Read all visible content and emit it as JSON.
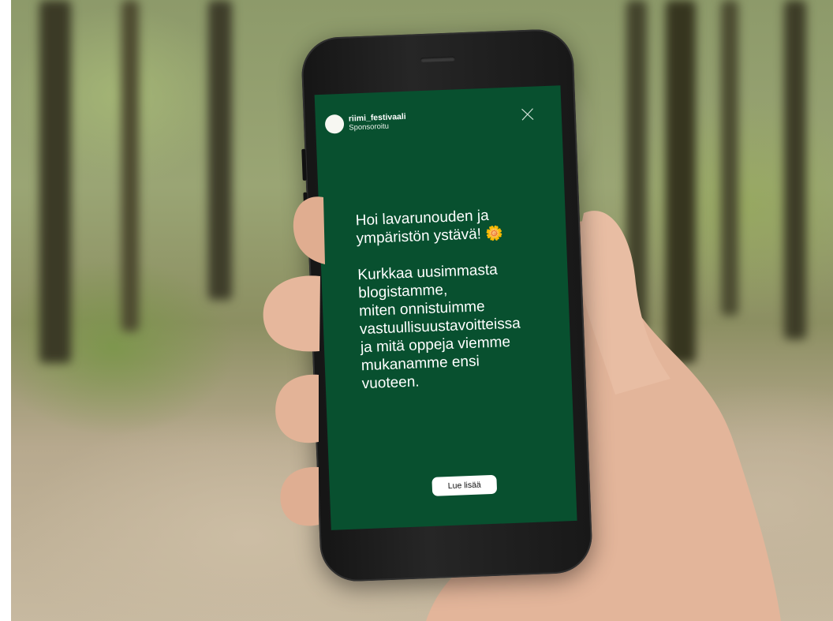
{
  "story": {
    "account_name": "riimi_festivaali",
    "sponsored_label": "Sponsoroitu",
    "greeting": "Hoi lavarunouden ja\nympäristön ystävä! ",
    "flower_emoji": "🌼",
    "body": "Kurkkaa uusimmasta\nblogistamme,\nmiten onnistuimme\nvastuullisuustavoitteissa\nja mitä oppeja viemme\nmukanamme ensi\nvuoteen.",
    "cta_label": "Lue lisää",
    "close_icon": "close-icon"
  },
  "colors": {
    "story_background": "#08502f",
    "text": "#ffffff",
    "button_background": "#ffffff"
  }
}
